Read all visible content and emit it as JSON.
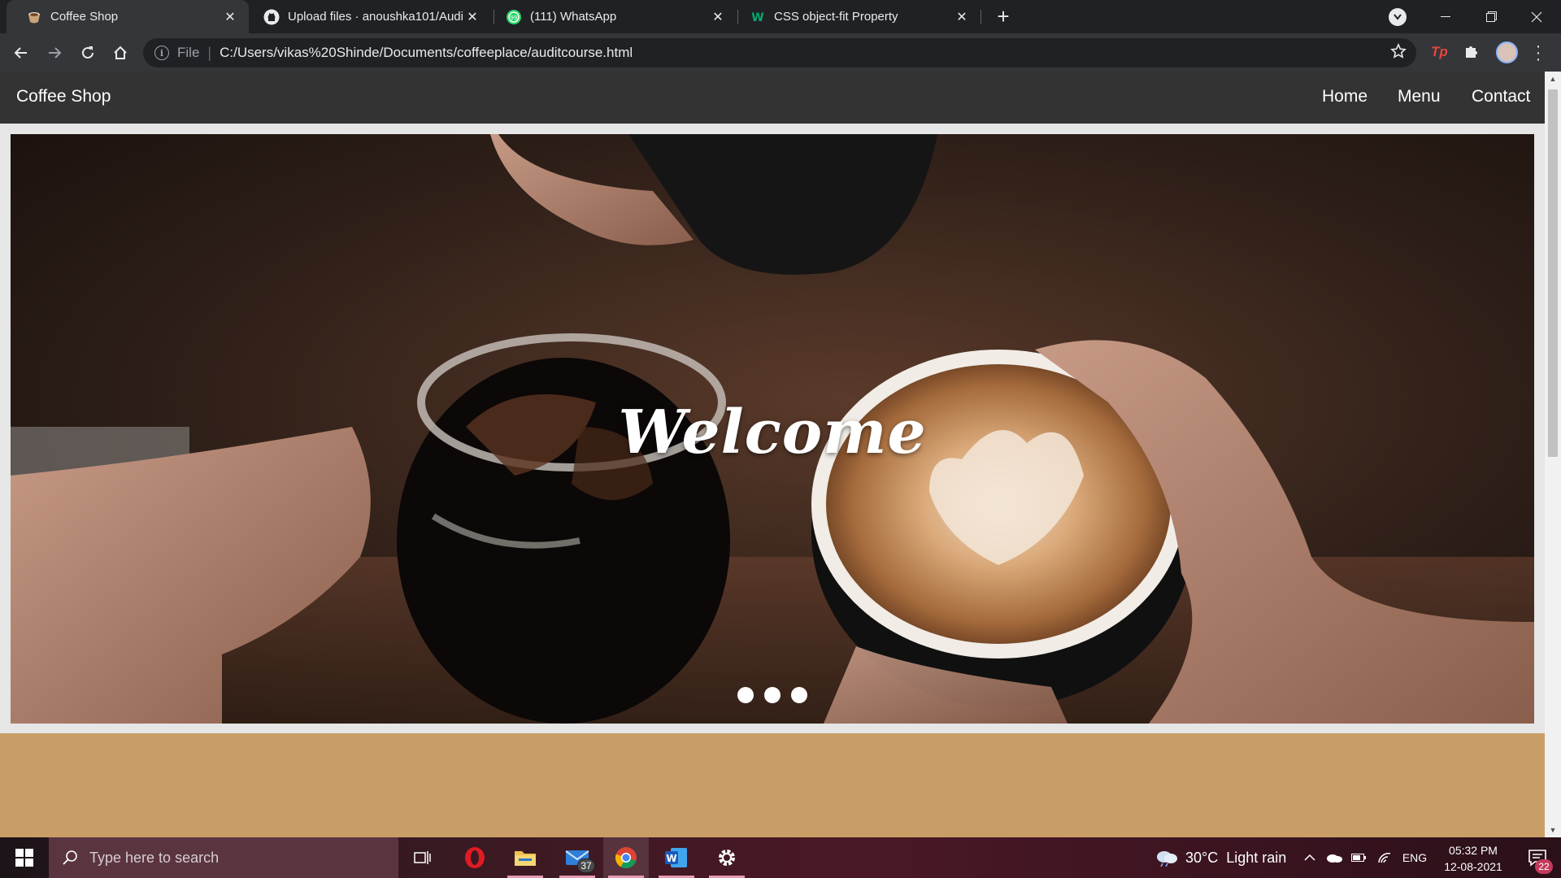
{
  "browser": {
    "tabs": [
      {
        "title": "Coffee Shop",
        "icon": "coffee-cup-icon",
        "active": true
      },
      {
        "title": "Upload files · anoushka101/Audit",
        "icon": "github-icon",
        "active": false
      },
      {
        "title": "(111) WhatsApp",
        "icon": "whatsapp-icon",
        "active": false
      },
      {
        "title": "CSS object-fit Property",
        "icon": "w3schools-icon",
        "active": false
      }
    ],
    "omnibox": {
      "scheme_label": "File",
      "url": "C:/Users/vikas%20Shinde/Documents/coffeeplace/auditcourse.html"
    },
    "extension_tp_label": "Tp"
  },
  "site": {
    "brand": "Coffee Shop",
    "nav": [
      "Home",
      "Menu",
      "Contact"
    ],
    "hero_text": "Welcome",
    "slide_count": 3
  },
  "taskbar": {
    "search_placeholder": "Type here to search",
    "mail_badge": "37",
    "word_letter": "W",
    "weather_temp": "30°C",
    "weather_desc": "Light rain",
    "language": "ENG",
    "time": "05:32 PM",
    "date": "12-08-2021",
    "notification_count": "22"
  },
  "colors": {
    "site_nav_bg": "#333333",
    "page_bg": "#c89e66",
    "browser_bg": "#202124"
  }
}
